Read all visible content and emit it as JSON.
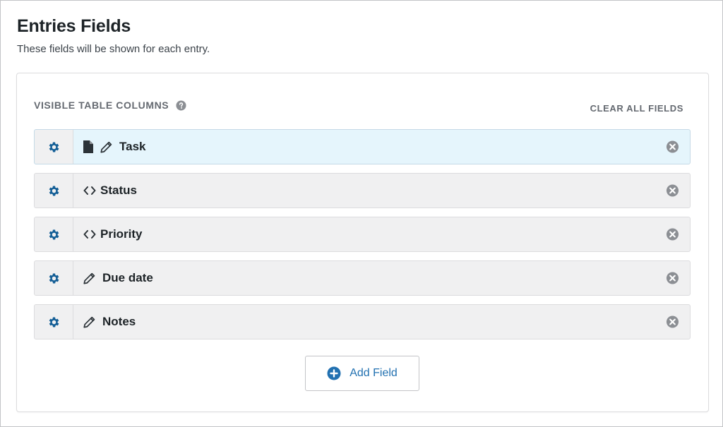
{
  "header": {
    "title": "Entries Fields",
    "subtitle": "These fields will be shown for each entry."
  },
  "panel": {
    "section_label": "VISIBLE TABLE COLUMNS",
    "clear_label": "CLEAR ALL FIELDS",
    "fields": [
      {
        "label": "Task",
        "icons": [
          "document-icon",
          "pencil-icon"
        ],
        "active": true
      },
      {
        "label": "Status",
        "icons": [
          "code-icon"
        ],
        "active": false
      },
      {
        "label": "Priority",
        "icons": [
          "code-icon"
        ],
        "active": false
      },
      {
        "label": "Due date",
        "icons": [
          "pencil-icon"
        ],
        "active": false
      },
      {
        "label": "Notes",
        "icons": [
          "pencil-icon"
        ],
        "active": false
      }
    ],
    "add_label": "Add Field"
  },
  "colors": {
    "accent": "#2271b1",
    "gear": "#135e96",
    "active_row": "#e5f5fc",
    "row": "#f0f0f1",
    "remove_icon": "#8c8f94"
  }
}
